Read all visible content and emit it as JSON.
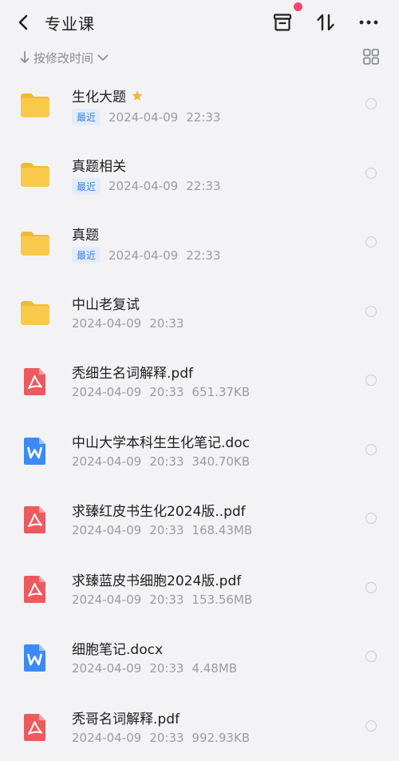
{
  "header": {
    "title": "专业课"
  },
  "sort": {
    "label": "按修改时间"
  },
  "items": [
    {
      "type": "folder",
      "name": "生化大题",
      "starred": true,
      "badge": "最近",
      "date": "2024-04-09",
      "time": "22:33",
      "size": ""
    },
    {
      "type": "folder",
      "name": "真题相关",
      "starred": false,
      "badge": "最近",
      "date": "2024-04-09",
      "time": "22:33",
      "size": ""
    },
    {
      "type": "folder",
      "name": "真题",
      "starred": false,
      "badge": "最近",
      "date": "2024-04-09",
      "time": "22:33",
      "size": ""
    },
    {
      "type": "folder",
      "name": "中山老复试",
      "starred": false,
      "badge": "",
      "date": "2024-04-09",
      "time": "20:33",
      "size": ""
    },
    {
      "type": "pdf",
      "name": "秃细生名词解释.pdf",
      "starred": false,
      "badge": "",
      "date": "2024-04-09",
      "time": "20:33",
      "size": "651.37KB"
    },
    {
      "type": "word",
      "name": "中山大学本科生生化笔记.doc",
      "starred": false,
      "badge": "",
      "date": "2024-04-09",
      "time": "20:33",
      "size": "340.70KB"
    },
    {
      "type": "pdf",
      "name": "求臻红皮书生化2024版..pdf",
      "starred": false,
      "badge": "",
      "date": "2024-04-09",
      "time": "20:33",
      "size": "168.43MB"
    },
    {
      "type": "pdf",
      "name": "求臻蓝皮书细胞2024版.pdf",
      "starred": false,
      "badge": "",
      "date": "2024-04-09",
      "time": "20:33",
      "size": "153.56MB"
    },
    {
      "type": "word",
      "name": "细胞笔记.docx",
      "starred": false,
      "badge": "",
      "date": "2024-04-09",
      "time": "20:33",
      "size": "4.48MB"
    },
    {
      "type": "pdf",
      "name": "秃哥名词解释.pdf",
      "starred": false,
      "badge": "",
      "date": "2024-04-09",
      "time": "20:33",
      "size": "992.93KB"
    }
  ],
  "icons": {
    "folder": "folder-icon",
    "pdf": "pdf-file-icon",
    "word": "word-file-icon"
  },
  "colors": {
    "folder": "#f9c94c",
    "pdf": "#ec5a5f",
    "word": "#3d8af7",
    "badge_text": "#3a7fe0",
    "star": "#f5b731",
    "notification_dot": "#f2496b"
  }
}
